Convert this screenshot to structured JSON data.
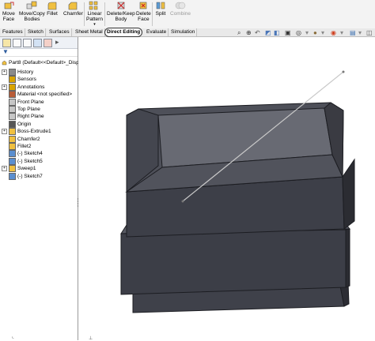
{
  "ribbon": {
    "buttons": [
      {
        "name": "move-face",
        "label": "Move\nFace"
      },
      {
        "name": "move-copy-bodies",
        "label": "Move/Copy\nBodies"
      },
      {
        "name": "fillet",
        "label": "Fillet"
      },
      {
        "name": "chamfer",
        "label": "Chamfer"
      },
      {
        "name": "linear-pattern",
        "label": "Linear\nPattern"
      },
      {
        "name": "delete-keep-body",
        "label": "Delete/Keep\nBody"
      },
      {
        "name": "delete-face",
        "label": "Delete\nFace"
      },
      {
        "name": "split",
        "label": "Split"
      },
      {
        "name": "combine",
        "label": "Combine"
      }
    ]
  },
  "tabs": [
    "Features",
    "Sketch",
    "Surfaces",
    "Sheet Metal",
    "Direct Editing",
    "Evaluate",
    "Simulation"
  ],
  "active_tab": "Direct Editing",
  "feature_tree": {
    "root": "Part8  (Default<<Default>_Disp",
    "items": [
      {
        "label": "History",
        "icon": "history-icon",
        "expand": true
      },
      {
        "label": "Sensors",
        "icon": "sensor-icon",
        "expand": false
      },
      {
        "label": "Annotations",
        "icon": "annotation-icon",
        "expand": true
      },
      {
        "label": "Material <not specified>",
        "icon": "material-icon",
        "expand": false
      },
      {
        "label": "Front Plane",
        "icon": "plane-icon",
        "expand": false
      },
      {
        "label": "Top Plane",
        "icon": "plane-icon",
        "expand": false
      },
      {
        "label": "Right Plane",
        "icon": "plane-icon",
        "expand": false
      },
      {
        "label": "Origin",
        "icon": "origin-icon",
        "expand": false
      },
      {
        "label": "Boss-Extrude1",
        "icon": "extrude-icon",
        "expand": true
      },
      {
        "label": "Chamfer2",
        "icon": "chamfer-icon",
        "expand": false
      },
      {
        "label": "Fillet2",
        "icon": "fillet-icon",
        "expand": false
      },
      {
        "label": "(-) Sketch4",
        "icon": "sketch-icon",
        "expand": false
      },
      {
        "label": "(-) Sketch5",
        "icon": "sketch-icon",
        "expand": false
      },
      {
        "label": "Sweep1",
        "icon": "sweep-icon",
        "expand": true
      },
      {
        "label": "(-) Sketch7",
        "icon": "sketch-icon",
        "expand": false
      }
    ]
  },
  "colors": {
    "model_front": "#3e4049",
    "model_top": "#63656f",
    "model_edge": "#1c1d22",
    "ribbon_bg": "#f3f3f3",
    "tree_bg": "#ffffff"
  }
}
